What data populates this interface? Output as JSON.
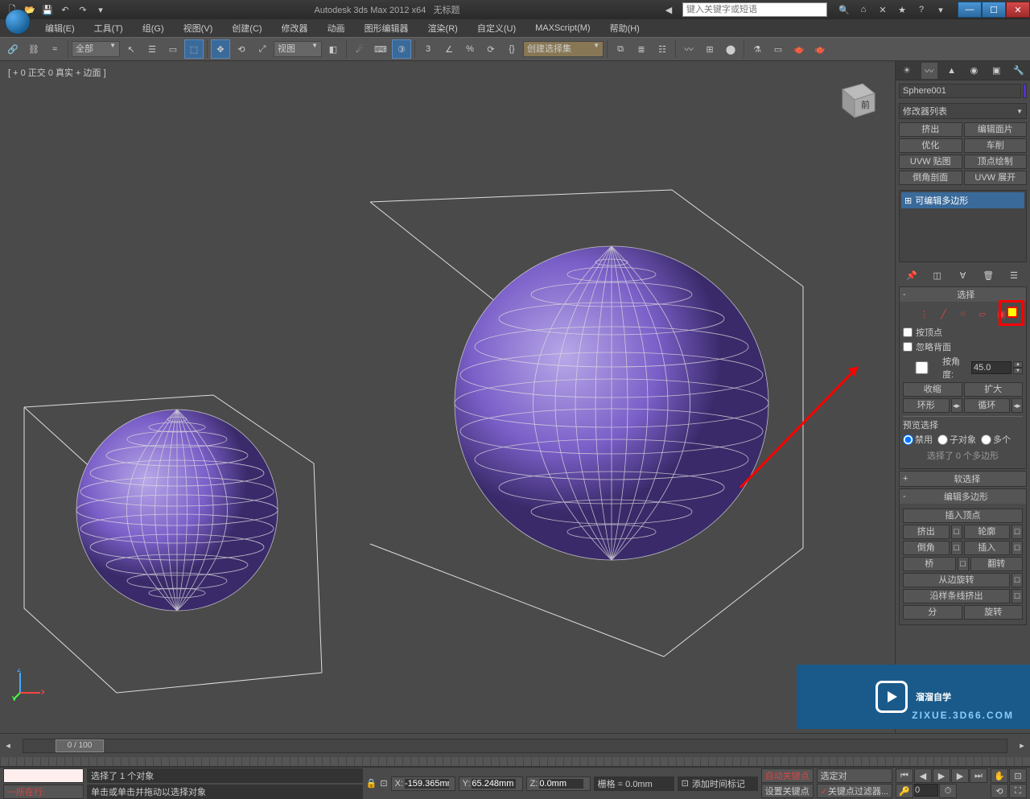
{
  "titlebar": {
    "app_title": "Autodesk 3ds Max 2012 x64",
    "doc_title": "无标题",
    "search_placeholder": "键入关键字或短语"
  },
  "menu": {
    "items": [
      "编辑(E)",
      "工具(T)",
      "组(G)",
      "视图(V)",
      "创建(C)",
      "修改器",
      "动画",
      "图形编辑器",
      "渲染(R)",
      "自定义(U)",
      "MAXScript(M)",
      "帮助(H)"
    ]
  },
  "toolbar": {
    "filter_all": "全部",
    "view_dropdown": "视图",
    "selection_set": "创建选择集"
  },
  "viewport": {
    "label": "[ + 0 正交 0 真实 + 边面 ]"
  },
  "panel": {
    "object_name": "Sphere001",
    "modifier_list_label": "修改器列表",
    "quick_buttons": [
      "挤出",
      "编辑面片",
      "优化",
      "车削",
      "UVW 贴图",
      "顶点绘制",
      "倒角剖面",
      "UVW 展开"
    ],
    "stack_item": "可编辑多边形",
    "selection": {
      "header": "选择",
      "by_vertex": "按顶点",
      "ignore_backfacing": "忽略背面",
      "by_angle": "按角度:",
      "angle_value": "45.0",
      "shrink": "收缩",
      "grow": "扩大",
      "ring": "环形",
      "loop": "循环",
      "preview_label": "预览选择",
      "preview_off": "禁用",
      "preview_subobj": "子对象",
      "preview_multi": "多个",
      "selected_info": "选择了 0 个多边形"
    },
    "soft_selection": "软选择",
    "edit_poly": {
      "header": "编辑多边形",
      "insert_vertex": "插入顶点",
      "extrude": "挤出",
      "outline": "轮廓",
      "bevel": "倒角",
      "insert": "插入",
      "bridge": "桥",
      "flip": "翻转",
      "hinge": "从边旋转",
      "extrude_spline": "沿样条线挤出",
      "edit_tri": "分",
      "retri": "旋转"
    }
  },
  "timeline": {
    "frame_display": "0 / 100"
  },
  "statusbar": {
    "script_label": "所在行:",
    "selection_info": "选择了 1 个对象",
    "hint": "单击或单击并拖动以选择对象",
    "x_label": "X:",
    "x_value": "-159.365mm",
    "y_label": "Y:",
    "y_value": "65.248mm",
    "z_label": "Z:",
    "z_value": "0.0mm",
    "grid": "栅格 = 0.0mm",
    "add_time_tag": "添加时间标记",
    "auto_key": "自动关键点",
    "set_key": "设置关键点",
    "selected_only": "选定对",
    "key_filter": "关键点过滤器..."
  },
  "watermark": {
    "text": "溜溜自学",
    "url": "ZIXUE.3D66.COM"
  },
  "icons": {
    "new": "🗋",
    "open": "📂",
    "save": "💾",
    "undo": "↶",
    "redo": "↷",
    "link": "🔗",
    "unlink": "⛓",
    "bind": "≈",
    "attach": "⟐",
    "search": "🔍",
    "star": "★",
    "globe": "🌐",
    "info": "ⓘ",
    "help": "?",
    "min": "—",
    "max": "☐",
    "close": "✕",
    "cursor": "↖",
    "rect": "▭",
    "window": "⬚",
    "cross": "✛",
    "fence": "⬠",
    "move": "✥",
    "rotate": "⟲",
    "scale": "⤢",
    "ref": "◧",
    "manip": "☰",
    "snap": "磁",
    "angle-snap": "∠",
    "percent": "%",
    "spinner": "⟳",
    "axis": "⊹",
    "mirror": "⧉",
    "align": "≣",
    "layers": "☷",
    "curve": "〰",
    "schematic": "⊞",
    "material": "⬤",
    "render": "🫖",
    "create-tab": "☀",
    "modify-tab": "〰",
    "hierarchy-tab": "▲",
    "motion-tab": "◉",
    "display-tab": "▣",
    "utilities-tab": "🔧",
    "pin": "📌",
    "show": "◫",
    "unique": "⊓",
    "remove": "✕",
    "config": "⚙"
  }
}
